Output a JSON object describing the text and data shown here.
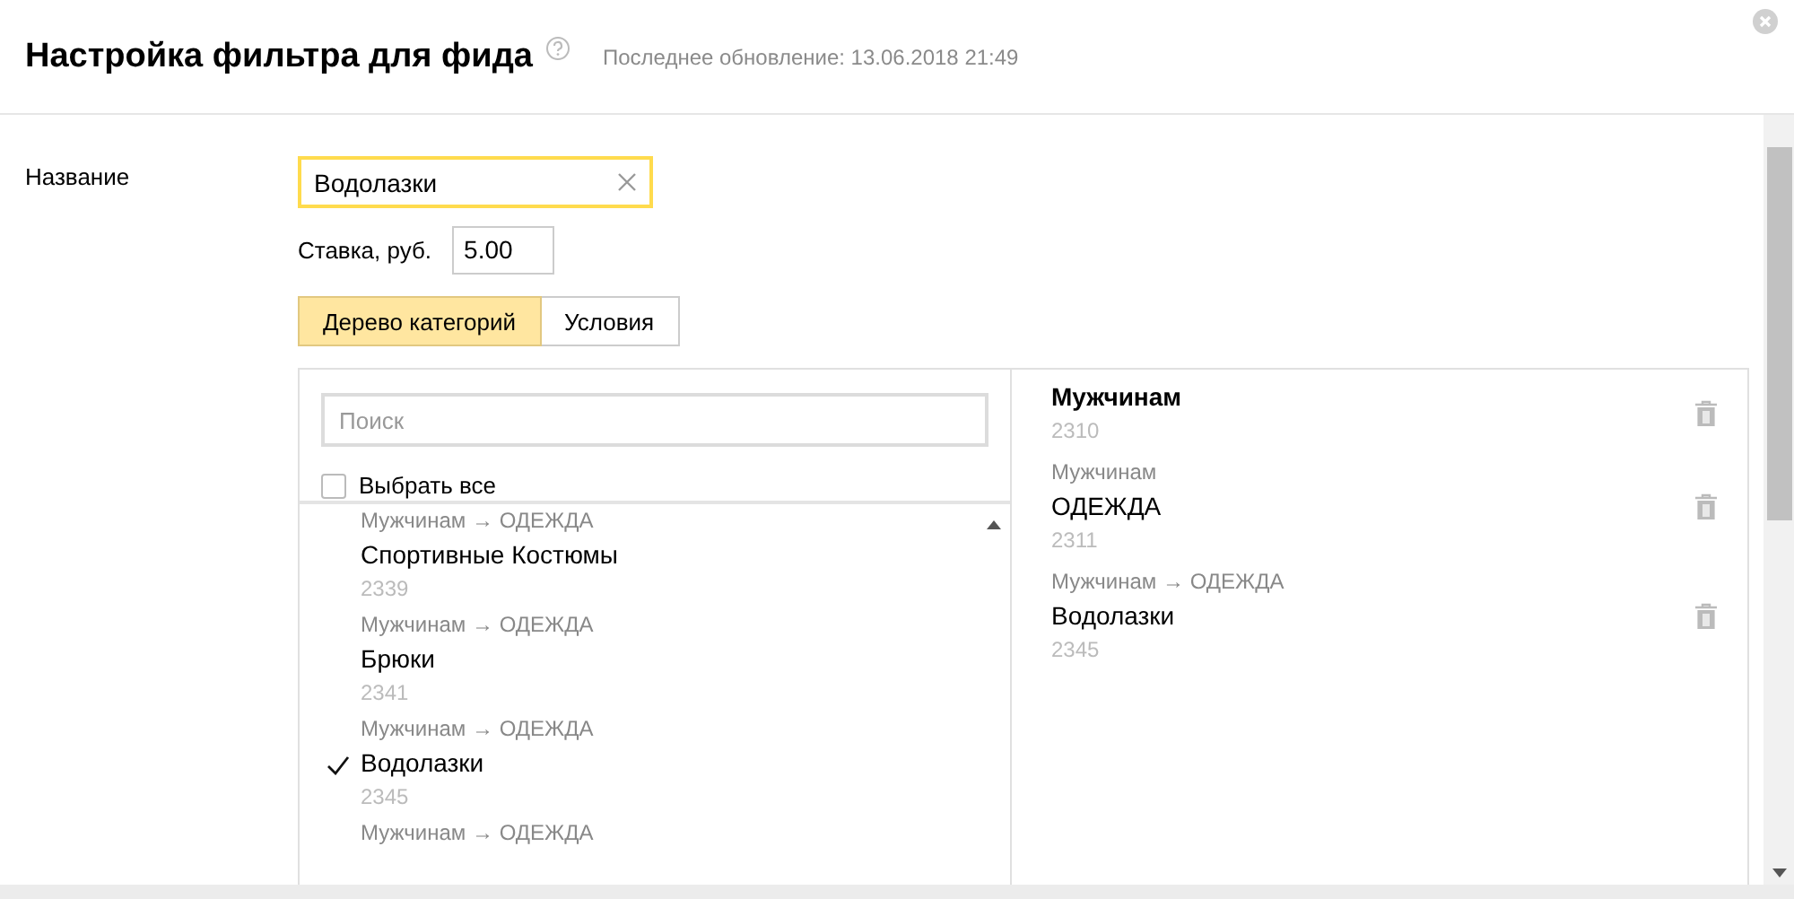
{
  "header": {
    "title": "Настройка фильтра для фида",
    "updated": "Последнее обновление: 13.06.2018 21:49"
  },
  "form": {
    "name_label": "Название",
    "name_value": "Водолазки",
    "rate_label": "Ставка, руб.",
    "rate_value": "5.00"
  },
  "tabs": [
    {
      "label": "Дерево категорий",
      "selected": true
    },
    {
      "label": "Условия",
      "selected": false
    }
  ],
  "tree": {
    "search_placeholder": "Поиск",
    "select_all": {
      "label": "Выбрать все",
      "checked": false
    },
    "items": [
      {
        "path": "Мужчинам → ОДЕЖДА",
        "name": "Спортивные Костюмы",
        "id": "2339",
        "checked": false
      },
      {
        "path": "Мужчинам → ОДЕЖДА",
        "name": "Брюки",
        "id": "2341",
        "checked": false
      },
      {
        "path": "Мужчинам → ОДЕЖДА",
        "name": "Водолазки",
        "id": "2345",
        "checked": true
      },
      {
        "path": "Мужчинам → ОДЕЖДА"
      }
    ]
  },
  "selected": [
    {
      "name": "Мужчинам",
      "id": "2310"
    },
    {
      "path": "Мужчинам",
      "name": "ОДЕЖДА",
      "id": "2311"
    },
    {
      "path": "Мужчинам → ОДЕЖДА",
      "name": "Водолазки",
      "id": "2345"
    }
  ]
}
